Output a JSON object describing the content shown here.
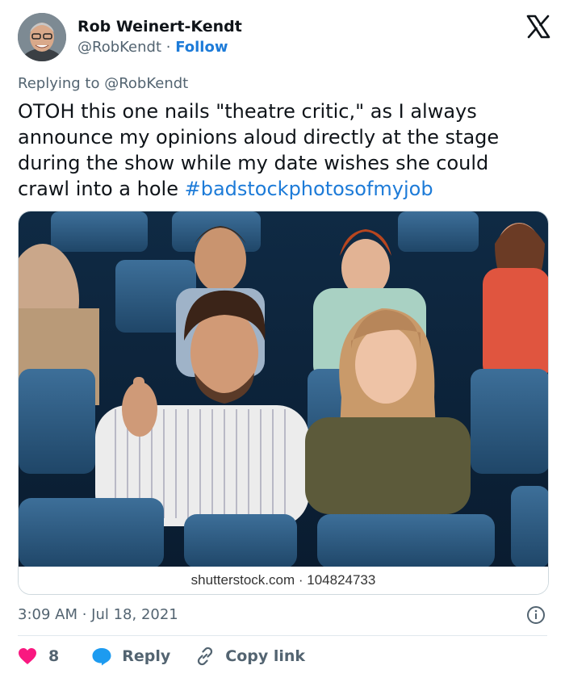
{
  "author": {
    "name": "Rob Weinert-Kendt",
    "handle": "@RobKendt",
    "separator": " · ",
    "follow_label": "Follow"
  },
  "replying": {
    "prefix": "Replying to ",
    "mention": "@RobKendt"
  },
  "tweet": {
    "text": "OTOH this one nails \"theatre critic,\" as I always announce my opinions aloud directly at the stage during the show while my date wishes she could crawl into a hole ",
    "hashtag": "#badstockphotosofmyjob"
  },
  "media": {
    "watermark": "shutterstock.com · 104824733"
  },
  "meta": {
    "timestamp": "3:09 AM · Jul 18, 2021"
  },
  "actions": {
    "like_count": "8",
    "reply_label": "Reply",
    "copy_label": "Copy link"
  },
  "colors": {
    "link": "#1d7bd8",
    "like": "#f91880",
    "reply": "#1d9bf0",
    "secondary_text": "#536471"
  }
}
